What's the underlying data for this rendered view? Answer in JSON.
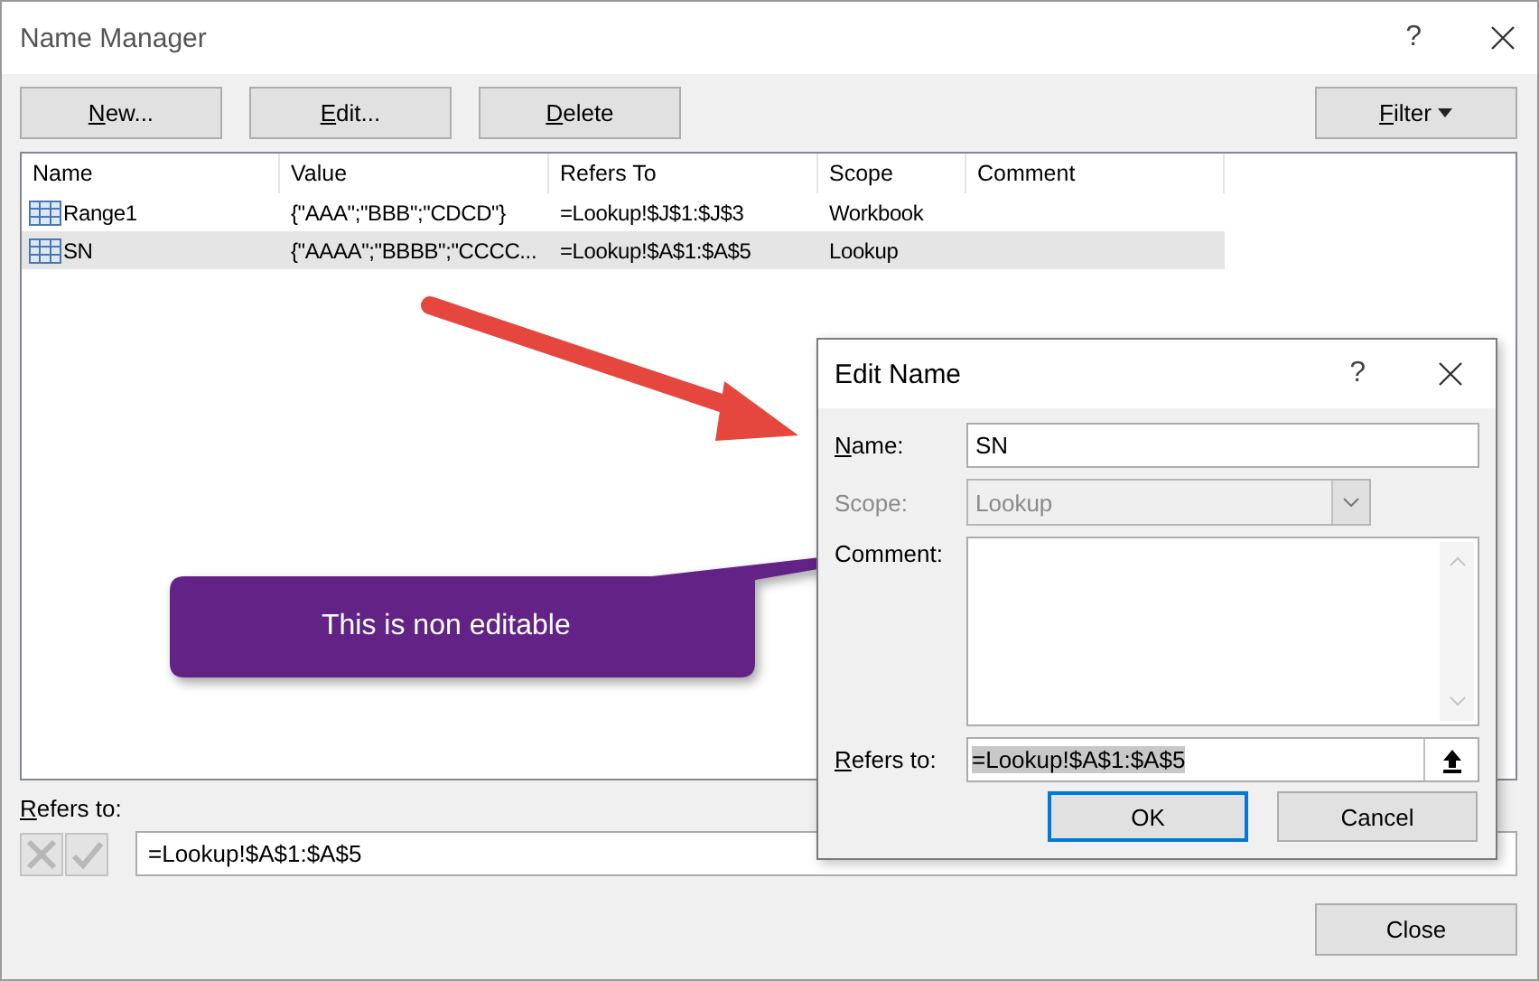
{
  "window": {
    "title": "Name Manager",
    "help": "?"
  },
  "toolbar": [
    {
      "label": "New..."
    },
    {
      "label": "Edit..."
    },
    {
      "label": "Delete"
    }
  ],
  "filter": {
    "label": "Filter"
  },
  "table": {
    "columns": [
      "Name",
      "Value",
      "Refers To",
      "Scope",
      "Comment"
    ],
    "rows": [
      {
        "selected": false,
        "cells": [
          "Range1",
          "{\"AAA\";\"BBB\";\"CDCD\"}",
          "=Lookup!$J$1:$J$3",
          "Workbook",
          ""
        ]
      },
      {
        "selected": true,
        "cells": [
          "SN",
          "{\"AAAA\";\"BBBB\";\"CCCC...",
          "=Lookup!$A$1:$A$5",
          "Lookup",
          ""
        ]
      }
    ]
  },
  "refers_to": {
    "label": "Refers to:",
    "value": "=Lookup!$A$1:$A$5"
  },
  "close_button": "Close",
  "edit_dialog": {
    "title": "Edit Name",
    "help": "?",
    "name": {
      "label": "Name:",
      "value": "SN"
    },
    "scope": {
      "label": "Scope:",
      "value": "Lookup",
      "disabled": true
    },
    "comment": {
      "label": "Comment:"
    },
    "refers_to": {
      "label": "Refers to:",
      "value": "=Lookup!$A$1:$A$5",
      "highlighted": true
    },
    "buttons": [
      {
        "label": "OK",
        "default": true
      },
      {
        "label": "Cancel",
        "default": false
      }
    ]
  },
  "annotation": {
    "text": "This is non editable"
  }
}
